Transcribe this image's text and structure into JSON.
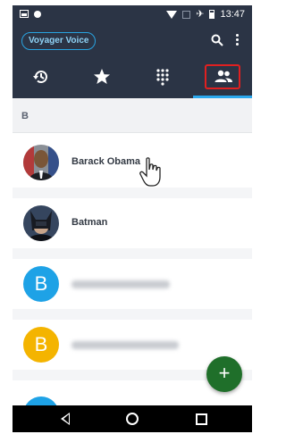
{
  "status_bar": {
    "time": "13:47"
  },
  "header": {
    "account_label": "Voyager Voice",
    "icons": [
      "search-icon",
      "overflow-menu-icon"
    ],
    "tabs": [
      {
        "name": "history",
        "icon": "history-icon"
      },
      {
        "name": "favorites",
        "icon": "star-icon"
      },
      {
        "name": "dialpad",
        "icon": "dialpad-icon"
      },
      {
        "name": "contacts",
        "icon": "contacts-icon",
        "selected": true
      }
    ]
  },
  "list": {
    "section_letter": "B",
    "contacts": [
      {
        "name": "Barack Obama",
        "avatar": "photo"
      },
      {
        "name": "Batman",
        "avatar": "photo"
      },
      {
        "avatar_letter": "B",
        "avatar_color": "#1ea2e6"
      },
      {
        "avatar_letter": "B",
        "avatar_color": "#f4b400"
      }
    ]
  },
  "fab": {
    "label": "+",
    "color": "#1f6f2a"
  },
  "colors": {
    "header": "#2b3445",
    "accent": "#2aa8ee",
    "highlight": "#e02020"
  }
}
